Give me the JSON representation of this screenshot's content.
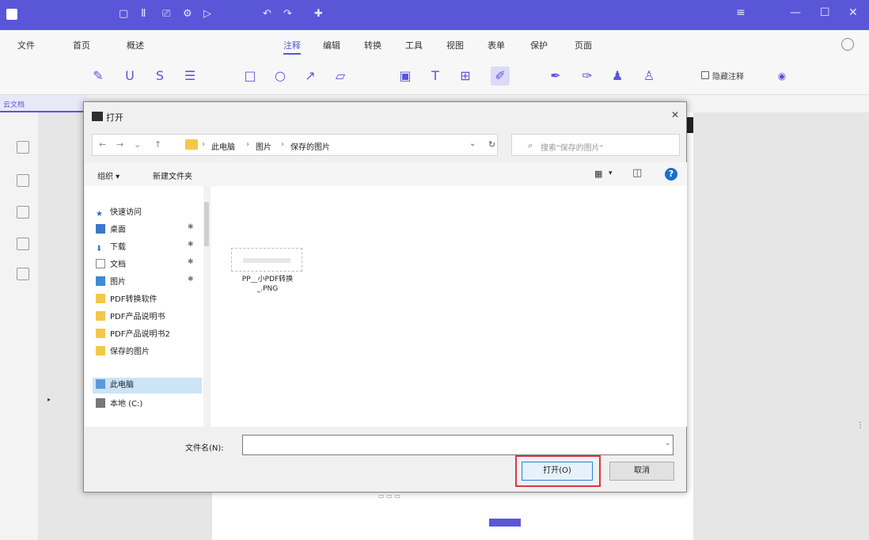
{
  "app": {
    "title": "",
    "quick_access_icons": [
      "save-icon",
      "undo-icon",
      "redo-icon",
      "print-icon",
      "share-icon",
      "expand-icon"
    ],
    "window_controls": [
      "minimize-icon",
      "maximize-icon",
      "close-icon"
    ]
  },
  "menu": {
    "items": [
      "文件",
      "首页",
      "概述",
      "注释",
      "编辑",
      "转换",
      "工具",
      "视图",
      "表单",
      "保护",
      "页面"
    ],
    "active": "注释"
  },
  "toolbar": {
    "tools": [
      "highlight-icon",
      "underline-icon",
      "strikethrough-icon",
      "text-markup-icon",
      "rectangle-icon",
      "circle-icon",
      "arrow-icon",
      "shape-icon",
      "stamp-icon",
      "text-icon",
      "textbox-icon",
      "pencil-icon",
      "brush-icon",
      "eraser-icon",
      "signature-icon",
      "user-stamp-icon"
    ],
    "checkbox_label": "隐藏注释"
  },
  "doc_tab": {
    "label": "云文档"
  },
  "dialog": {
    "title": "打开",
    "breadcrumb": [
      "此电脑",
      "图片",
      "保存的图片"
    ],
    "search_placeholder": "搜索\"保存的图片\"",
    "commands": {
      "organize": "组织 ▾",
      "new_folder": "新建文件夹"
    },
    "nav_items": [
      {
        "label": "快速访问",
        "icon": "star-icon",
        "pinned": false
      },
      {
        "label": "桌面",
        "icon": "desktop-icon",
        "pinned": true
      },
      {
        "label": "下载",
        "icon": "download-icon",
        "pinned": true
      },
      {
        "label": "文档",
        "icon": "document-icon",
        "pinned": true
      },
      {
        "label": "图片",
        "icon": "picture-icon",
        "pinned": true
      },
      {
        "label": "PDF转换软件",
        "icon": "folder-icon",
        "pinned": false
      },
      {
        "label": "PDF产品说明书",
        "icon": "folder-icon",
        "pinned": false
      },
      {
        "label": "PDF产品说明书2",
        "icon": "folder-icon",
        "pinned": false
      },
      {
        "label": "保存的图片",
        "icon": "folder-icon",
        "pinned": false
      },
      {
        "label": "此电脑",
        "icon": "computer-icon",
        "pinned": false,
        "selected": true
      },
      {
        "label": "本地 (C:)",
        "icon": "drive-icon",
        "pinned": false
      }
    ],
    "file": {
      "name_line1": "PP__小PDF转换",
      "name_line2": "_.PNG"
    },
    "filename_label": "文件名(N):",
    "filename_value": "",
    "open_label": "打开(O)",
    "cancel_label": "取消"
  },
  "colors": {
    "brand": "#5a56d8",
    "highlight_box": "#d03a4a",
    "primary_button_border": "#2f7ed8"
  }
}
